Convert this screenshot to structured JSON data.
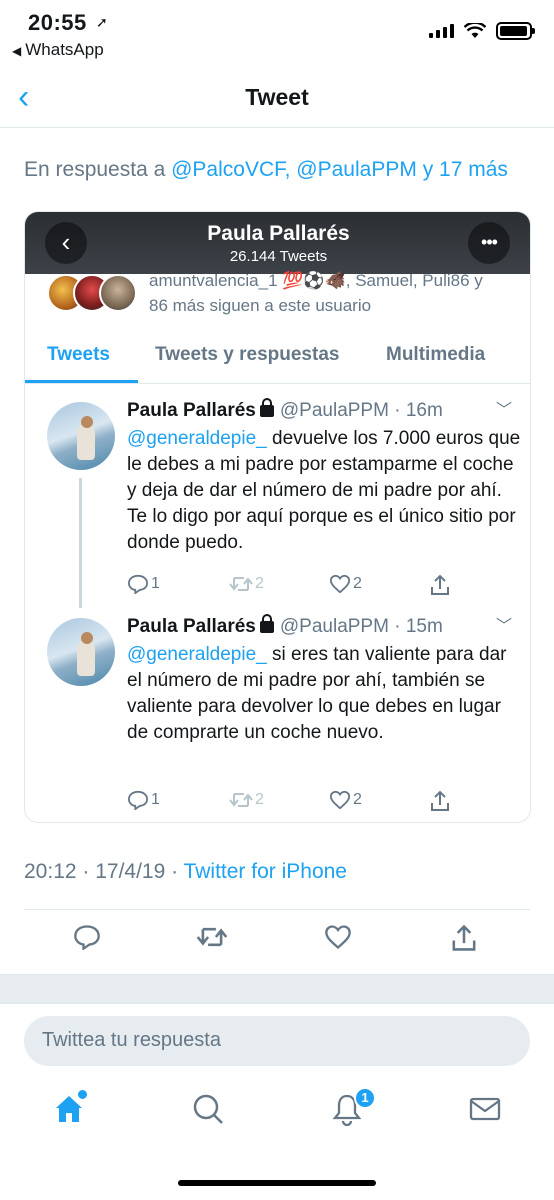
{
  "status_bar": {
    "time": "20:55",
    "back_app": "WhatsApp",
    "battery_level": 0.95
  },
  "nav": {
    "title": "Tweet",
    "back_icon": "chevron-left-icon"
  },
  "reply_to": {
    "prefix": "En respuesta a",
    "users": "@PalcoVCF, @PaulaPPM",
    "and": "y",
    "more": "17 más"
  },
  "embedded_profile": {
    "name": "Paula Pallarés",
    "tweet_count": "26.144 Tweets",
    "followers_line1": "amuntvalencia_1 💯⚽️🐗, Samuel, Puli86 y",
    "followers_line2": "86 más siguen a este usuario",
    "tabs": [
      {
        "label": "Tweets",
        "active": true
      },
      {
        "label": "Tweets y respuestas",
        "active": false
      },
      {
        "label": "Multimedia",
        "active": false
      }
    ],
    "tweets": [
      {
        "name": "Paula Pallarés",
        "handle": "@PaulaPPM · 16m",
        "mention": "@generaldepie_",
        "text": " devuelve los 7.000 euros que le debes a mi padre por estamparme el coche y deja de dar el número de mi padre por ahí. Te lo digo por aquí porque es el único sitio por donde puedo.",
        "replies": "1",
        "retweets": "2",
        "likes": "2"
      },
      {
        "name": "Paula Pallarés",
        "handle": "@PaulaPPM · 15m",
        "mention": "@generaldepie_",
        "text": " si eres tan valiente para dar el número de mi padre por ahí, también se valiente para devolver lo que debes en lugar de comprarte un coche nuevo.",
        "replies": "1",
        "retweets": "2",
        "likes": "2"
      }
    ]
  },
  "meta": {
    "timestamp": "20:12 · 17/4/19 ·",
    "source": "Twitter for iPhone"
  },
  "reply_input": {
    "placeholder": "Twittea tu respuesta"
  },
  "tabbar": {
    "notification_badge": "1"
  },
  "colors": {
    "accent": "#1da1f2",
    "muted": "#657786",
    "text": "#14171a"
  }
}
